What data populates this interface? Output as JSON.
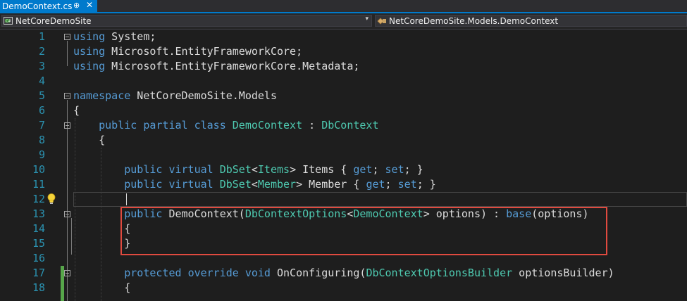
{
  "tab": {
    "title": "DemoContext.cs",
    "pin_glyph": "⊕",
    "close_glyph": "✕"
  },
  "navbar": {
    "project": "NetCoreDemoSite",
    "class_path": "NetCoreDemoSite.Models.DemoContext",
    "dropdown_glyph": "▾"
  },
  "editor": {
    "line_numbers": [
      "1",
      "2",
      "3",
      "4",
      "5",
      "6",
      "7",
      "8",
      "9",
      "10",
      "11",
      "12",
      "13",
      "14",
      "15",
      "16",
      "17",
      "18"
    ],
    "lines": [
      [
        [
          "k",
          "using"
        ],
        [
          "g",
          " System;"
        ]
      ],
      [
        [
          "k",
          "using"
        ],
        [
          "g",
          " Microsoft.EntityFrameworkCore;"
        ]
      ],
      [
        [
          "k",
          "using"
        ],
        [
          "g",
          " Microsoft.EntityFrameworkCore.Metadata;"
        ]
      ],
      [],
      [
        [
          "k",
          "namespace"
        ],
        [
          "g",
          " NetCoreDemoSite.Models"
        ]
      ],
      [
        [
          "g",
          "{"
        ]
      ],
      [
        [
          "g",
          "    "
        ],
        [
          "k",
          "public"
        ],
        [
          "g",
          " "
        ],
        [
          "k",
          "partial"
        ],
        [
          "g",
          " "
        ],
        [
          "k",
          "class"
        ],
        [
          "g",
          " "
        ],
        [
          "t",
          "DemoContext"
        ],
        [
          "g",
          " : "
        ],
        [
          "t",
          "DbContext"
        ]
      ],
      [
        [
          "g",
          "    {"
        ]
      ],
      [],
      [
        [
          "g",
          "        "
        ],
        [
          "k",
          "public"
        ],
        [
          "g",
          " "
        ],
        [
          "k",
          "virtual"
        ],
        [
          "g",
          " "
        ],
        [
          "t",
          "DbSet"
        ],
        [
          "g",
          "<"
        ],
        [
          "t",
          "Items"
        ],
        [
          "g",
          "> Items { "
        ],
        [
          "k",
          "get"
        ],
        [
          "g",
          "; "
        ],
        [
          "k",
          "set"
        ],
        [
          "g",
          "; }"
        ]
      ],
      [
        [
          "g",
          "        "
        ],
        [
          "k",
          "public"
        ],
        [
          "g",
          " "
        ],
        [
          "k",
          "virtual"
        ],
        [
          "g",
          " "
        ],
        [
          "t",
          "DbSet"
        ],
        [
          "g",
          "<"
        ],
        [
          "t",
          "Member"
        ],
        [
          "g",
          "> Member { "
        ],
        [
          "k",
          "get"
        ],
        [
          "g",
          "; "
        ],
        [
          "k",
          "set"
        ],
        [
          "g",
          "; }"
        ]
      ],
      [],
      [
        [
          "g",
          "        "
        ],
        [
          "k",
          "public"
        ],
        [
          "g",
          " DemoContext("
        ],
        [
          "t",
          "DbContextOptions"
        ],
        [
          "g",
          "<"
        ],
        [
          "t",
          "DemoContext"
        ],
        [
          "g",
          "> options) : "
        ],
        [
          "k",
          "base"
        ],
        [
          "g",
          "(options)"
        ]
      ],
      [
        [
          "g",
          "        {"
        ]
      ],
      [
        [
          "g",
          "        }"
        ]
      ],
      [],
      [
        [
          "g",
          "        "
        ],
        [
          "k",
          "protected"
        ],
        [
          "g",
          " "
        ],
        [
          "k",
          "override"
        ],
        [
          "g",
          " "
        ],
        [
          "k",
          "void"
        ],
        [
          "g",
          " OnConfiguring("
        ],
        [
          "t",
          "DbContextOptionsBuilder"
        ],
        [
          "g",
          " optionsBuilder)"
        ]
      ],
      [
        [
          "g",
          "        {"
        ]
      ]
    ]
  },
  "colors": {
    "keyword": "#569cd6",
    "type": "#4ec9b0",
    "text": "#dcdcdc",
    "line_number": "#2b91af",
    "highlight_box": "#e04a3f",
    "tab_active": "#007acc",
    "change_bar": "#57a64a"
  },
  "icons": [
    "pin-icon",
    "close-icon",
    "csharp-project-icon",
    "class-icon",
    "lightbulb-icon",
    "fold-toggle-icon"
  ]
}
